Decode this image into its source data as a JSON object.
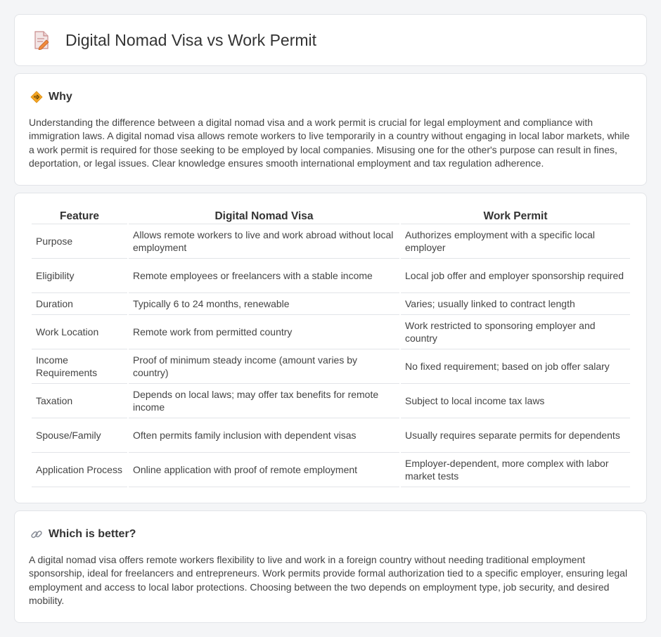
{
  "header": {
    "title": "Digital Nomad Visa vs Work Permit",
    "icon": "document-pen-icon"
  },
  "why": {
    "icon": "signpost-icon",
    "title": "Why",
    "text": "Understanding the difference between a digital nomad visa and a work permit is crucial for legal employment and compliance with immigration laws. A digital nomad visa allows remote workers to live temporarily in a country without engaging in local labor markets, while a work permit is required for those seeking to be employed by local companies. Misusing one for the other's purpose can result in fines, deportation, or legal issues. Clear knowledge ensures smooth international employment and tax regulation adherence."
  },
  "table": {
    "headers": [
      "Feature",
      "Digital Nomad Visa",
      "Work Permit"
    ],
    "rows": [
      [
        "Purpose",
        "Allows remote workers to live and work abroad without local employment",
        "Authorizes employment with a specific local employer"
      ],
      [
        "Eligibility",
        "Remote employees or freelancers with a stable income",
        "Local job offer and employer sponsorship required"
      ],
      [
        "Duration",
        "Typically 6 to 24 months, renewable",
        "Varies; usually linked to contract length"
      ],
      [
        "Work Location",
        "Remote work from permitted country",
        "Work restricted to sponsoring employer and country"
      ],
      [
        "Income Requirements",
        "Proof of minimum steady income (amount varies by country)",
        "No fixed requirement; based on job offer salary"
      ],
      [
        "Taxation",
        "Depends on local laws; may offer tax benefits for remote income",
        "Subject to local income tax laws"
      ],
      [
        "Spouse/Family",
        "Often permits family inclusion with dependent visas",
        "Usually requires separate permits for dependents"
      ],
      [
        "Application Process",
        "Online application with proof of remote employment",
        "Employer-dependent, more complex with labor market tests"
      ]
    ]
  },
  "better": {
    "icon": "link-icon",
    "title": "Which is better?",
    "text": "A digital nomad visa offers remote workers flexibility to live and work in a foreign country without needing traditional employment sponsorship, ideal for freelancers and entrepreneurs. Work permits provide formal authorization tied to a specific employer, ensuring legal employment and access to local labor protections. Choosing between the two depends on employment type, job security, and desired mobility."
  }
}
